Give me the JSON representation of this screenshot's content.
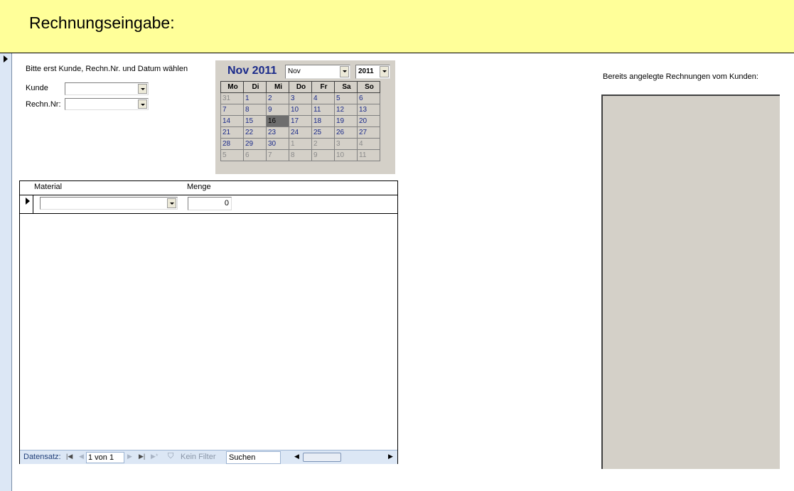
{
  "header": {
    "title": "Rechnungseingabe:"
  },
  "form": {
    "instruction": "Bitte erst Kunde, Rechn.Nr. und Datum wählen",
    "kunde_label": "Kunde",
    "kunde_value": "",
    "rechnr_label": "Rechn.Nr:",
    "rechnr_value": ""
  },
  "calendar": {
    "title": "Nov 2011",
    "month_select": "Nov",
    "year_select": "2011",
    "weekdays": [
      "Mo",
      "Di",
      "Mi",
      "Do",
      "Fr",
      "Sa",
      "So"
    ],
    "weeks": [
      [
        "31",
        "1",
        "2",
        "3",
        "4",
        "5",
        "6"
      ],
      [
        "7",
        "8",
        "9",
        "10",
        "11",
        "12",
        "13"
      ],
      [
        "14",
        "15",
        "16",
        "17",
        "18",
        "19",
        "20"
      ],
      [
        "21",
        "22",
        "23",
        "24",
        "25",
        "26",
        "27"
      ],
      [
        "28",
        "29",
        "30",
        "1",
        "2",
        "3",
        "4"
      ],
      [
        "5",
        "6",
        "7",
        "8",
        "9",
        "10",
        "11"
      ]
    ],
    "selected_day": "16",
    "colors": {
      "current_month": "#1a2a8a",
      "other_month": "#8a8a8a",
      "selected_bg": "#6e6e6e"
    }
  },
  "subform": {
    "columns": [
      "Material",
      "Menge"
    ],
    "row": {
      "material": "",
      "menge": "0"
    },
    "nav": {
      "label": "Datensatz:",
      "record": "1 von 1",
      "filter": "Kein Filter",
      "search": "Suchen"
    }
  },
  "right": {
    "label": "Bereits angelegte Rechnungen vom Kunden:"
  },
  "colors": {
    "header_bg": "#ffff99",
    "panel_bg": "#d4d0c8",
    "nav_bg": "#dce7f5"
  }
}
